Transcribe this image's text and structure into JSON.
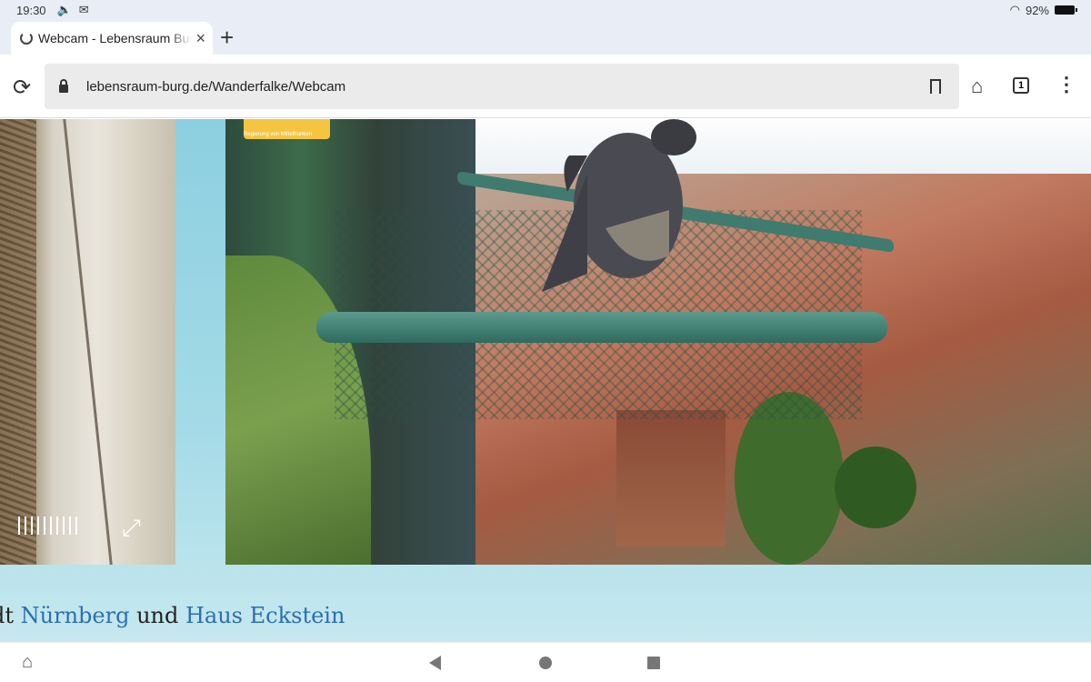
{
  "status": {
    "time": "19:30",
    "battery": "92%",
    "icons": [
      "volume-icon",
      "mail-icon",
      "wifi-icon",
      "battery-icon"
    ]
  },
  "tab": {
    "title": "Webcam - Lebensraum Burg",
    "close_icon": "×",
    "new_tab_icon": "+"
  },
  "toolbar": {
    "url": "lebensraum-burg.de/Wanderfalke/Webcam",
    "tab_count": "1"
  },
  "cam": {
    "logo_text": "Regierung von Mittelfranken"
  },
  "footer": {
    "prefix": "dt ",
    "link1": "Nürnberg",
    "middle": " und ",
    "link2": "Haus Eckstein",
    "link_color": "#2b6fae"
  }
}
